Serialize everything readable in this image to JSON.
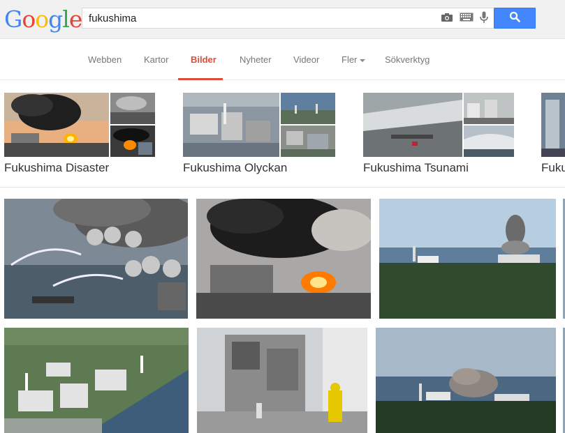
{
  "logo": {
    "letters": [
      "G",
      "o",
      "o",
      "g",
      "l",
      "e"
    ]
  },
  "search": {
    "query": "fukushima"
  },
  "icons": {
    "camera": "camera-icon",
    "keyboard": "keyboard-icon",
    "mic": "microphone-icon",
    "search": "search-icon"
  },
  "tabs": [
    {
      "label": "Webben"
    },
    {
      "label": "Kartor"
    },
    {
      "label": "Bilder"
    },
    {
      "label": "Nyheter"
    },
    {
      "label": "Videor"
    },
    {
      "label": "Fler"
    },
    {
      "label": "Sökverktyg"
    }
  ],
  "active_tab": "Bilder",
  "related": [
    {
      "label": "Fukushima Disaster"
    },
    {
      "label": "Fukushima Olyckan"
    },
    {
      "label": "Fukushima Tsunami"
    },
    {
      "label": "Fuku"
    }
  ],
  "colors": {
    "accent": "#dd4b39",
    "search_button": "#4387fd"
  }
}
